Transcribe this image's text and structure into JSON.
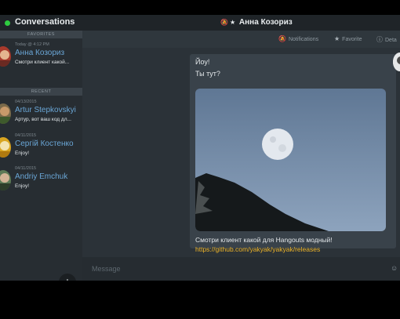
{
  "window": {
    "title": "Conversations",
    "chat_title": "Анна Козориз",
    "chat_title_icons": [
      "bell-off-icon",
      "star-icon"
    ]
  },
  "sidebar": {
    "favorites_header": "FAVORITES",
    "recent_header": "RECENT",
    "favorites": [
      {
        "date": "Today @ 4:12 PM",
        "name": "Анна Козориз",
        "snippet": "Смотри клиент какой..."
      }
    ],
    "recent": [
      {
        "date": "04/13/2015",
        "name": "Artur Stepkovskyi",
        "snippet": "Артур, вот ваш код дл..."
      },
      {
        "date": "04/11/2015",
        "name": "Сергій Костенко",
        "snippet": "Enjoy!"
      },
      {
        "date": "04/11/2015",
        "name": "Andriy Emchuk",
        "snippet": "Enjoy!"
      }
    ],
    "add_label": "+"
  },
  "toolbar": {
    "notifications": "Notifications",
    "favorite": "Favorite",
    "details": "Deta"
  },
  "message": {
    "line1": "Йоу!",
    "line2": "Ты тут?",
    "caption": "Смотри клиент какой для Hangouts модный!",
    "link": "https://github.com/yakyak/yakyak/releases"
  },
  "composer": {
    "placeholder": "Message",
    "emoji_icon": "emoji-icon"
  },
  "colors": {
    "accent_name": "#6aa6d6",
    "link": "#f0b629",
    "online": "#2ecc40",
    "sidebar_bg": "#272d32",
    "main_bg": "#2b3238"
  }
}
